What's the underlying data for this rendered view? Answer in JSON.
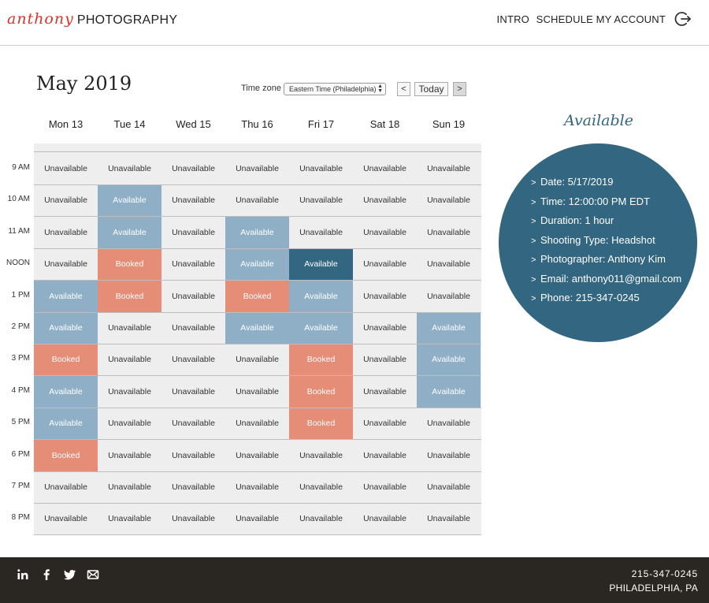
{
  "brand": {
    "script": "anthony",
    "word": "PHOTOGRAPHY",
    "accent": "#d8342c"
  },
  "nav": {
    "intro": "INTRO",
    "schedule": "SCHEDULE",
    "account": "MY ACCOUNT",
    "logout_icon": "logout-icon"
  },
  "calendar": {
    "title": "May 2019",
    "timezone_label": "Time zone",
    "timezone_value": "Eastern Time (Philadelphia)",
    "prev": "<",
    "today": "Today",
    "next": ">",
    "days": [
      "Mon 13",
      "Tue 14",
      "Wed 15",
      "Thu 16",
      "Fri 17",
      "Sat 18",
      "Sun 19"
    ],
    "times": [
      "9 AM",
      "10 AM",
      "11 AM",
      "NOON",
      "1 PM",
      "2 PM",
      "3 PM",
      "4 PM",
      "5 PM",
      "6 PM",
      "7 PM",
      "8 PM"
    ],
    "slots": [
      [
        "Unavailable",
        "Unavailable",
        "Unavailable",
        "Unavailable",
        "Unavailable",
        "Unavailable",
        "Unavailable"
      ],
      [
        "Unavailable",
        "Available",
        "Unavailable",
        "Unavailable",
        "Unavailable",
        "Unavailable",
        "Unavailable"
      ],
      [
        "Unavailable",
        "Available",
        "Unavailable",
        "Available",
        "Unavailable",
        "Unavailable",
        "Unavailable"
      ],
      [
        "Unavailable",
        "Booked",
        "Unavailable",
        "Available",
        "Available",
        "Unavailable",
        "Unavailable"
      ],
      [
        "Available",
        "Booked",
        "Unavailable",
        "Booked",
        "Available",
        "Unavailable",
        "Unavailable"
      ],
      [
        "Available",
        "Unavailable",
        "Unavailable",
        "Available",
        "Available",
        "Unavailable",
        "Available"
      ],
      [
        "Booked",
        "Unavailable",
        "Unavailable",
        "Unavailable",
        "Booked",
        "Unavailable",
        "Available"
      ],
      [
        "Available",
        "Unavailable",
        "Unavailable",
        "Unavailable",
        "Booked",
        "Unavailable",
        "Available"
      ],
      [
        "Available",
        "Unavailable",
        "Unavailable",
        "Unavailable",
        "Booked",
        "Unavailable",
        "Unavailable"
      ],
      [
        "Booked",
        "Unavailable",
        "Unavailable",
        "Unavailable",
        "Unavailable",
        "Unavailable",
        "Unavailable"
      ],
      [
        "Unavailable",
        "Unavailable",
        "Unavailable",
        "Unavailable",
        "Unavailable",
        "Unavailable",
        "Unavailable"
      ],
      [
        "Unavailable",
        "Unavailable",
        "Unavailable",
        "Unavailable",
        "Unavailable",
        "Unavailable",
        "Unavailable"
      ]
    ],
    "selected": {
      "row": 3,
      "col": 4
    },
    "colors": {
      "available": "#8fafc6",
      "booked": "#e68d78",
      "selected": "#336680",
      "unavailable": "#eeeeee"
    }
  },
  "detail": {
    "status": "Available",
    "items": [
      "Date: 5/17/2019",
      "Time: 12:00:00 PM EDT",
      "Duration: 1 hour",
      "Shooting Type: Headshot",
      "Photographer: Anthony Kim",
      "Email: anthony011@gmail.com",
      "Phone: 215-347-0245"
    ],
    "bullet": ">",
    "color": "#336680"
  },
  "footer": {
    "phone": "215-347-0245",
    "city": "PHILADELPHIA, PA",
    "social": [
      "linkedin-icon",
      "facebook-icon",
      "twitter-icon",
      "email-icon"
    ],
    "background": "#2a2622"
  }
}
